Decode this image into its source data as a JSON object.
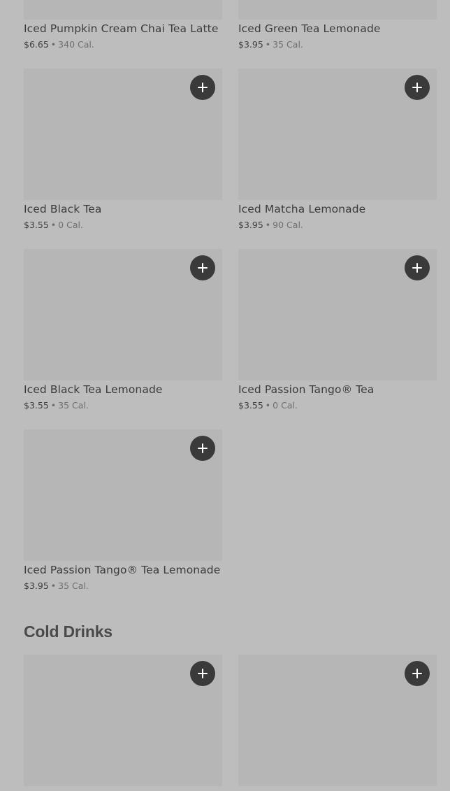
{
  "top_row": [
    {
      "name": "Iced Pumpkin Cream Chai Tea Latte",
      "price": "$6.65",
      "calories": "340 Cal."
    },
    {
      "name": "Iced Green Tea Lemonade",
      "price": "$3.95",
      "calories": "35 Cal."
    }
  ],
  "products": [
    {
      "name": "Iced Black Tea",
      "price": "$3.55",
      "calories": "0 Cal."
    },
    {
      "name": "Iced Matcha Lemonade",
      "price": "$3.95",
      "calories": "90 Cal."
    },
    {
      "name": "Iced Black Tea Lemonade",
      "price": "$3.55",
      "calories": "35 Cal."
    },
    {
      "name": "Iced Passion Tango® Tea",
      "price": "$3.55",
      "calories": "0 Cal."
    },
    {
      "name": "Iced Passion Tango® Tea Lemonade",
      "price": "$3.95",
      "calories": "35 Cal."
    }
  ],
  "cold_drinks": {
    "title": "Cold Drinks"
  },
  "separator": "•",
  "icons": {
    "add": "plus-icon"
  },
  "colors": {
    "background": "#bdbdbd",
    "thumbnail": "#b6b6b6",
    "add_button": "#3a3a3a"
  }
}
